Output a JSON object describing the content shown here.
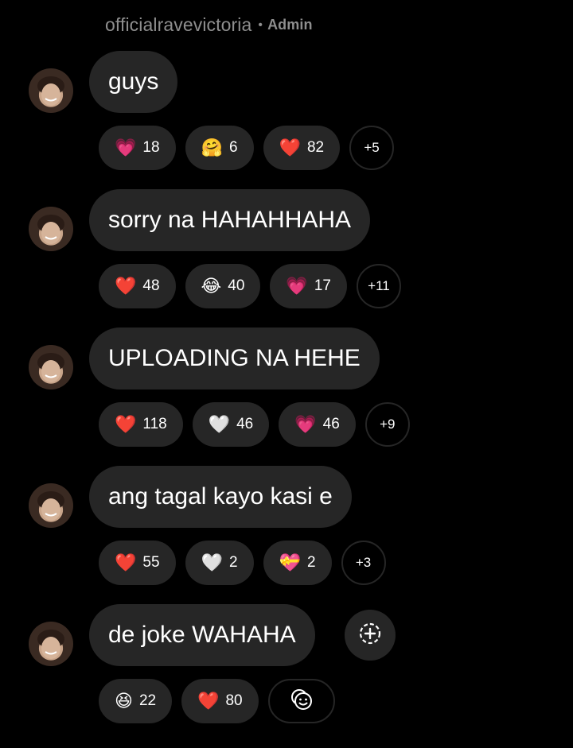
{
  "sender": {
    "username": "officialravevictoria",
    "separator": "•",
    "role": "Admin"
  },
  "colors": {
    "background": "#000000",
    "bubble": "#262626",
    "text": "#ffffff",
    "muted": "#8e8e8e"
  },
  "messages": [
    {
      "text": "guys",
      "reactions": [
        {
          "emoji": "💗",
          "count": "18"
        },
        {
          "emoji": "🤗",
          "count": "6"
        },
        {
          "emoji": "❤️",
          "count": "82"
        }
      ],
      "more": "+5"
    },
    {
      "text": "sorry na HAHAHHAHA",
      "reactions": [
        {
          "emoji": "❤️",
          "count": "48"
        },
        {
          "emoji": "😂",
          "count": "40"
        },
        {
          "emoji": "💗",
          "count": "17"
        }
      ],
      "more": "+11"
    },
    {
      "text": "UPLOADING NA HEHE",
      "reactions": [
        {
          "emoji": "❤️",
          "count": "118"
        },
        {
          "emoji": "🤍",
          "count": "46"
        },
        {
          "emoji": "💗",
          "count": "46"
        }
      ],
      "more": "+9"
    },
    {
      "text": "ang tagal kayo kasi e",
      "reactions": [
        {
          "emoji": "❤️",
          "count": "55"
        },
        {
          "emoji": "🤍",
          "count": "2"
        },
        {
          "emoji": "💝",
          "count": "2"
        }
      ],
      "more": "+3"
    },
    {
      "text": "de joke WAHAHA",
      "reactions": [
        {
          "emoji": "😆",
          "count": "22"
        },
        {
          "emoji": "❤️",
          "count": "80"
        }
      ],
      "add_reaction_icon": "add-reaction-icon",
      "emoji_picker_icon": "emoji-picker-icon"
    }
  ]
}
